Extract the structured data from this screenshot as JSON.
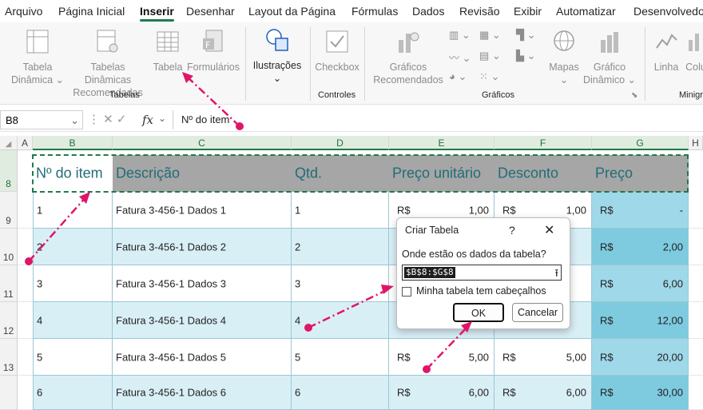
{
  "tabs": [
    "Arquivo",
    "Página Inicial",
    "Inserir",
    "Desenhar",
    "Layout da Página",
    "Fórmulas",
    "Dados",
    "Revisão",
    "Exibir",
    "Automatizar",
    "Desenvolvedo"
  ],
  "ribbon": {
    "tabela_dinamica": [
      "Tabela",
      "Dinâmica ⌄"
    ],
    "tabelas_recomendadas": [
      "Tabelas Dinâmicas",
      "Recomendadas"
    ],
    "tabela": "Tabela",
    "formularios": "Formulários",
    "ilustracoes": "Ilustrações",
    "ilustracoes_chevron": "⌄",
    "checkbox": "Checkbox",
    "graficos_recomendados": [
      "Gráficos",
      "Recomendados"
    ],
    "mapas": "Mapas",
    "mapas_chevron": "⌄",
    "grafico_dinamico": [
      "Gráfico",
      "Dinâmico ⌄"
    ],
    "linha": "Linha",
    "coluna": "Colu",
    "group_tabelas": "Tabelas",
    "group_controles": "Controles",
    "group_graficos": "Gráficos",
    "group_minigraficos": "Minigr"
  },
  "formula_bar": {
    "name_box": "B8",
    "fx": "fx",
    "formula": "Nº do item"
  },
  "columns": [
    "A",
    "B",
    "C",
    "D",
    "E",
    "F",
    "G",
    "H"
  ],
  "rows": [
    "8",
    "9",
    "10",
    "11",
    "12",
    "13"
  ],
  "table": {
    "headers": [
      "Nº do item",
      "Descrição",
      "Qtd.",
      "Preço unitário",
      "Desconto",
      "Preço"
    ],
    "rows": [
      {
        "item": "1",
        "desc": "Fatura 3-456-1 Dados 1",
        "qtd": "1",
        "unit_cur": "R$",
        "unit": "1,00",
        "desc_cur": "R$",
        "disc": "1,00",
        "price_cur": "R$",
        "price": "-"
      },
      {
        "item": "2",
        "desc": "Fatura 3-456-1 Dados 2",
        "qtd": "2",
        "unit_cur": "",
        "unit": "",
        "desc_cur": "",
        "disc": "",
        "price_cur": "R$",
        "price": "2,00"
      },
      {
        "item": "3",
        "desc": "Fatura 3-456-1 Dados 3",
        "qtd": "3",
        "unit_cur": "",
        "unit": "",
        "desc_cur": "",
        "disc": "",
        "price_cur": "R$",
        "price": "6,00"
      },
      {
        "item": "4",
        "desc": "Fatura 3-456-1 Dados 4",
        "qtd": "4",
        "unit_cur": "",
        "unit": "",
        "desc_cur": "",
        "disc": "",
        "price_cur": "R$",
        "price": "12,00"
      },
      {
        "item": "5",
        "desc": "Fatura 3-456-1 Dados 5",
        "qtd": "5",
        "unit_cur": "R$",
        "unit": "5,00",
        "desc_cur": "R$",
        "disc": "5,00",
        "price_cur": "R$",
        "price": "20,00"
      },
      {
        "item": "6",
        "desc": "Fatura 3-456-1 Dados 6",
        "qtd": "6",
        "unit_cur": "R$",
        "unit": "6,00",
        "desc_cur": "R$",
        "disc": "6,00",
        "price_cur": "R$",
        "price": "30,00"
      }
    ]
  },
  "dialog": {
    "title": "Criar Tabela",
    "help": "?",
    "close": "✕",
    "prompt": "Onde estão os dados da tabela?",
    "range": "$B$8:$G$8",
    "upload": "⭱",
    "checkbox_label": "Minha tabela tem cabeçalhos",
    "ok": "OK",
    "cancel": "Cancelar"
  },
  "colors": {
    "accent": "#1f7a4a",
    "header_fill": "#a6a6a6",
    "header_text": "#216c78",
    "band": "#d9eff6",
    "price_band": "#8fd3e6",
    "annotation": "#e0156a"
  }
}
